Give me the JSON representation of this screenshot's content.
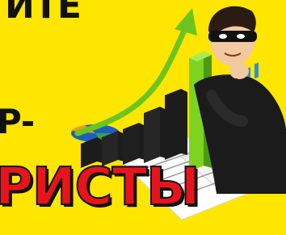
{
  "headline": {
    "line1": "ИТЕ",
    "line2": "Р-",
    "line3": "РИСТЫ"
  },
  "colors": {
    "background": "#ffe600",
    "headline_dark": "#111111",
    "headline_red": "#e8141c",
    "arrow_green": "#6cc51e",
    "bars": "#1c1c1c",
    "paper": "#ffffff",
    "chart_lines": "#2f8fd8"
  }
}
